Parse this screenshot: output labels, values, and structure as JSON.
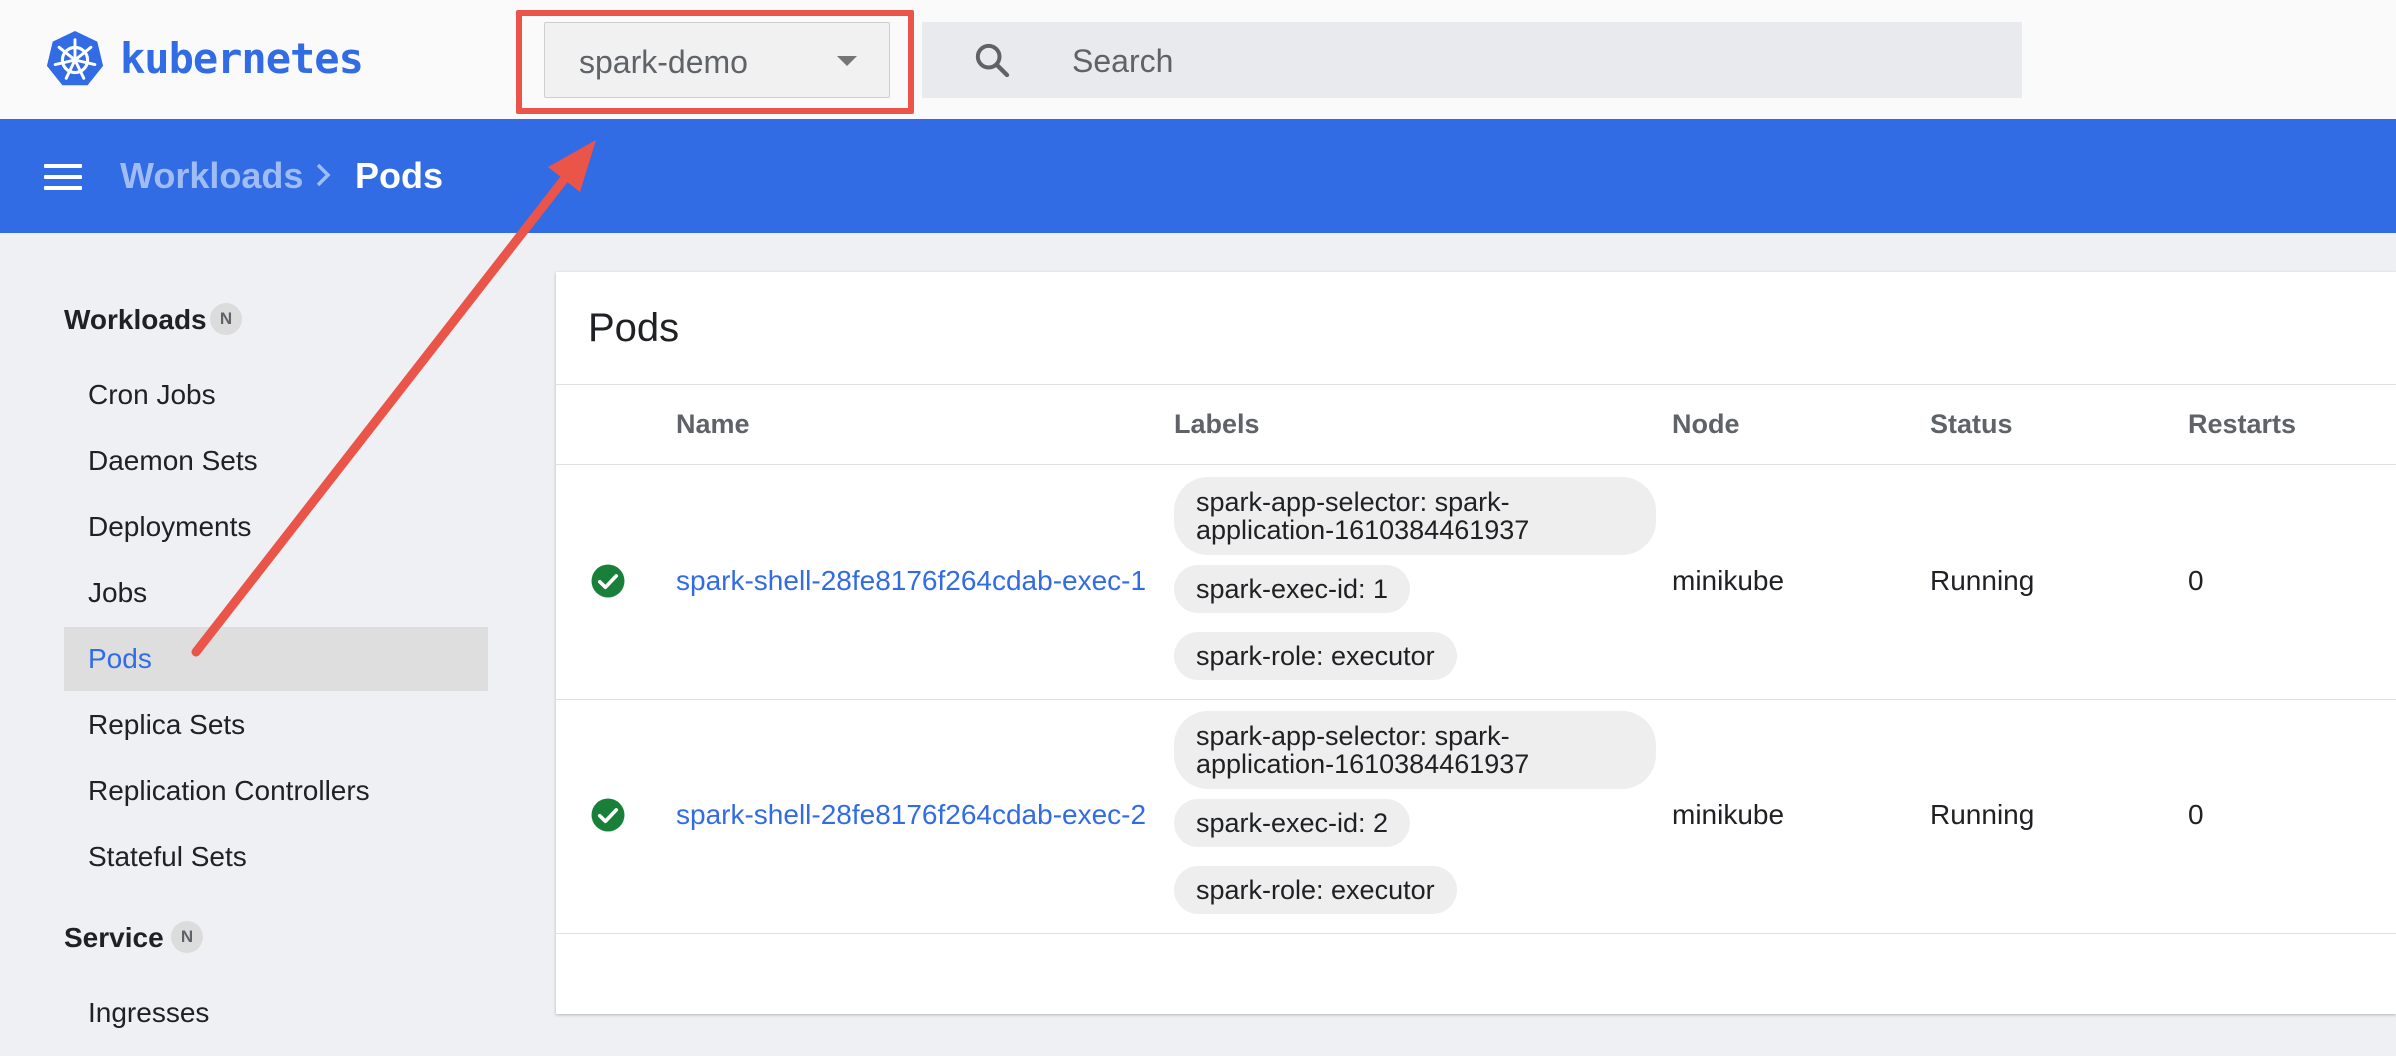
{
  "app": {
    "brand": "kubernetes"
  },
  "namespace": {
    "selected": "spark-demo"
  },
  "search": {
    "placeholder": "Search"
  },
  "breadcrumb": {
    "parent": "Workloads",
    "current": "Pods"
  },
  "sidebar": {
    "sections": [
      {
        "label": "Workloads",
        "badge": "N"
      },
      {
        "label": "Service",
        "badge": "N"
      }
    ],
    "workload_items": [
      {
        "label": "Cron Jobs"
      },
      {
        "label": "Daemon Sets"
      },
      {
        "label": "Deployments"
      },
      {
        "label": "Jobs"
      },
      {
        "label": "Pods",
        "active": true
      },
      {
        "label": "Replica Sets"
      },
      {
        "label": "Replication Controllers"
      },
      {
        "label": "Stateful Sets"
      }
    ],
    "service_items": [
      {
        "label": "Ingresses"
      }
    ]
  },
  "pods_card": {
    "title": "Pods",
    "columns": [
      "Name",
      "Labels",
      "Node",
      "Status",
      "Restarts"
    ],
    "rows": [
      {
        "status_icon": "check-circle-icon",
        "name": "spark-shell-28fe8176f264cdab-exec-1",
        "labels": [
          "spark-app-selector: spark-application-1610384461937",
          "spark-exec-id: 1",
          "spark-role: executor"
        ],
        "node": "minikube",
        "status": "Running",
        "restarts": "0"
      },
      {
        "status_icon": "check-circle-icon",
        "name": "spark-shell-28fe8176f264cdab-exec-2",
        "labels": [
          "spark-app-selector: spark-application-1610384461937",
          "spark-exec-id: 2",
          "spark-role: executor"
        ],
        "node": "minikube",
        "status": "Running",
        "restarts": "0"
      }
    ]
  },
  "colors": {
    "brand_blue": "#326ce5",
    "success_green": "#188038",
    "annotation_red": "#ea5449"
  }
}
